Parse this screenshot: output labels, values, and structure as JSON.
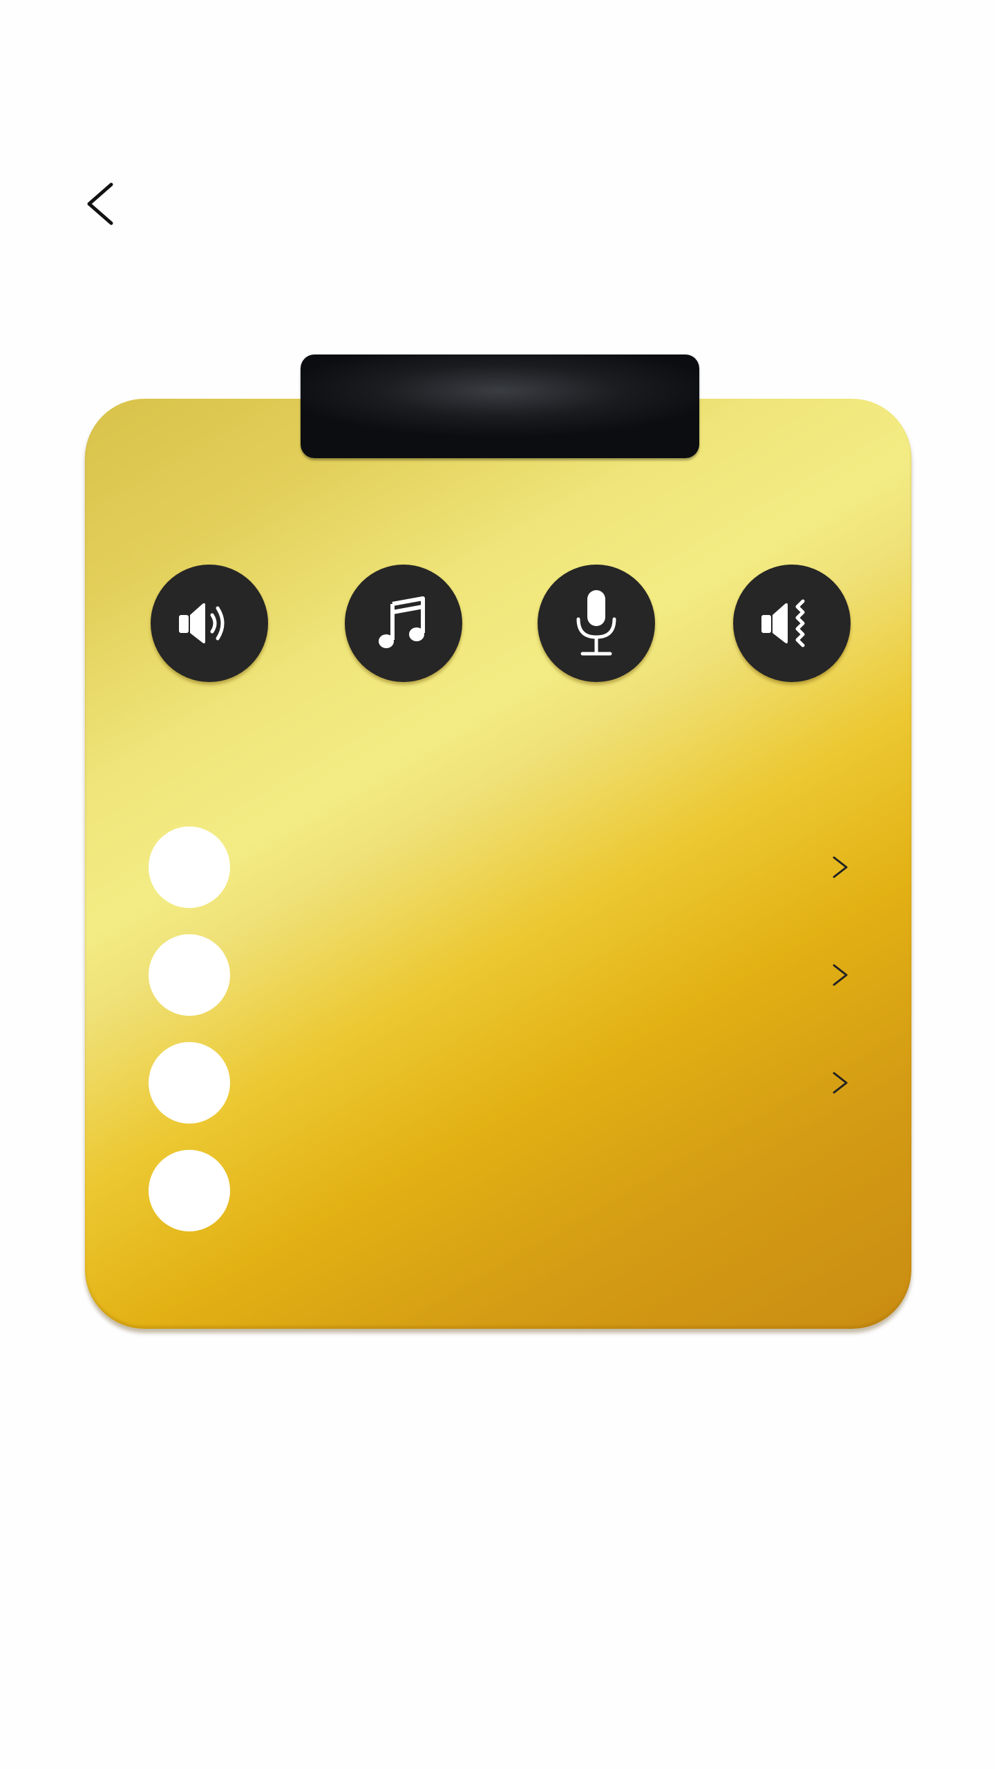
{
  "nav": {
    "back_icon": "chevron-left-icon"
  },
  "card": {
    "tab_label": "",
    "colors": {
      "gold_light": "#f3ec84",
      "gold_mid": "#ecc832",
      "gold_dark": "#c98c12",
      "tab_black": "#0b0d10",
      "button_dark": "#262626"
    }
  },
  "modes": [
    {
      "name": "speaker",
      "icon": "speaker-sound-icon"
    },
    {
      "name": "music",
      "icon": "music-note-icon"
    },
    {
      "name": "microphone",
      "icon": "microphone-icon"
    },
    {
      "name": "speaker-vibration",
      "icon": "speaker-vibration-icon"
    }
  ],
  "settings": {
    "items": [
      {
        "label": "",
        "has_chevron": true
      },
      {
        "label": "",
        "has_chevron": true
      },
      {
        "label": "",
        "has_chevron": true
      },
      {
        "label": "",
        "has_chevron": false
      }
    ]
  }
}
